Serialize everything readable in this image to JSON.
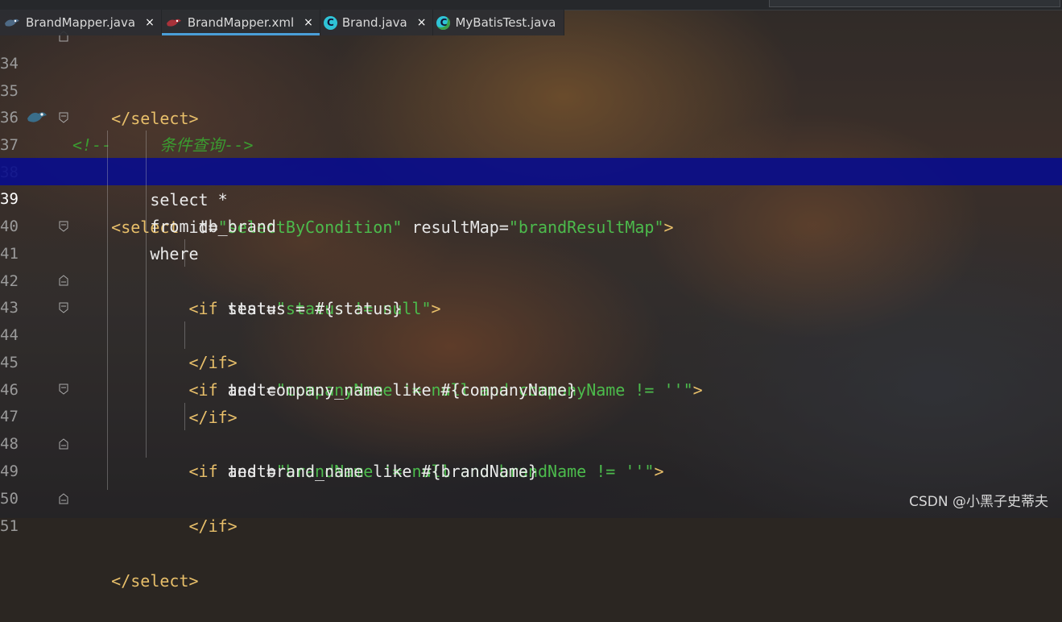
{
  "tabs": [
    {
      "label": "BrandMapper.java",
      "icon": "mybatis-bird-icon",
      "active": false
    },
    {
      "label": "BrandMapper.xml",
      "icon": "mybatis-bird-xml-icon",
      "active": true
    },
    {
      "label": "Brand.java",
      "icon": "java-class-icon",
      "active": false
    },
    {
      "label": "MyBatisTest.java",
      "icon": "java-test-class-icon",
      "active": false
    }
  ],
  "close_glyph": "×",
  "editor": {
    "current_line": "39",
    "lines": [
      {
        "num": "34",
        "code": "    </select>"
      },
      {
        "num": "35",
        "code": ""
      },
      {
        "num": "36",
        "code": "<!--     条件查询-->"
      },
      {
        "num": "37",
        "code": "    <select id=\"selectByCondition\" resultMap=\"brandResultMap\">"
      },
      {
        "num": "38",
        "code": "        select *"
      },
      {
        "num": "39",
        "code": "        from tb_brand"
      },
      {
        "num": "40",
        "code": "        where"
      },
      {
        "num": "41",
        "code": "            <if test=\"status != null\">"
      },
      {
        "num": "42",
        "code": "                status = #{status}"
      },
      {
        "num": "43",
        "code": "            </if>"
      },
      {
        "num": "44",
        "code": "            <if test=\"companyName != null and companyName != ''\">"
      },
      {
        "num": "45",
        "code": "                and company_name like #{companyName}"
      },
      {
        "num": "46",
        "code": "            </if>"
      },
      {
        "num": "47",
        "code": "            <if test=\"brandName != null and brandName != ''\">"
      },
      {
        "num": "48",
        "code": "                and brand_name like #{brandName}"
      },
      {
        "num": "49",
        "code": "            </if>"
      },
      {
        "num": "50",
        "code": ""
      },
      {
        "num": "51",
        "code": "    </select>"
      }
    ]
  },
  "colors": {
    "highlight": "#080c8c",
    "tag": "#e8bf6a",
    "attr_value": "#4cbb4c",
    "comment": "#3b9b30",
    "active_tab_underline": "#4a9fd8"
  },
  "watermark": "CSDN @小黑子史蒂夫"
}
